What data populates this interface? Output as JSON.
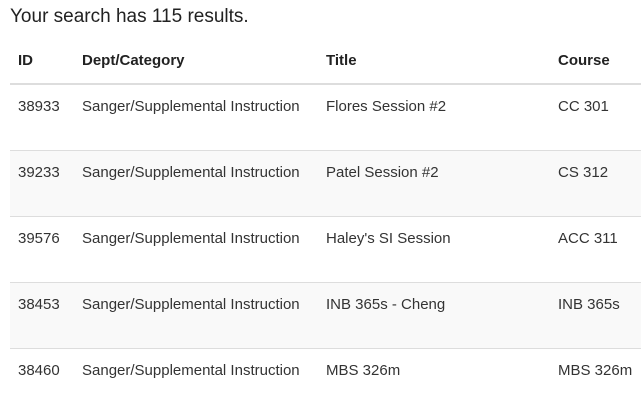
{
  "search": {
    "summary": "Your search has 115 results."
  },
  "table": {
    "headers": {
      "id": "ID",
      "dept": "Dept/Category",
      "title": "Title",
      "course": "Course"
    },
    "rows": [
      {
        "id": "38933",
        "dept": "Sanger/Supplemental Instruction",
        "title": "Flores Session #2",
        "course": "CC 301"
      },
      {
        "id": "39233",
        "dept": "Sanger/Supplemental Instruction",
        "title": "Patel Session #2",
        "course": "CS 312"
      },
      {
        "id": "39576",
        "dept": "Sanger/Supplemental Instruction",
        "title": "Haley's SI Session",
        "course": "ACC 311"
      },
      {
        "id": "38453",
        "dept": "Sanger/Supplemental Instruction",
        "title": "INB 365s - Cheng",
        "course": "INB 365s"
      },
      {
        "id": "38460",
        "dept": "Sanger/Supplemental Instruction",
        "title": "MBS 326m",
        "course": "MBS 326m"
      }
    ]
  }
}
